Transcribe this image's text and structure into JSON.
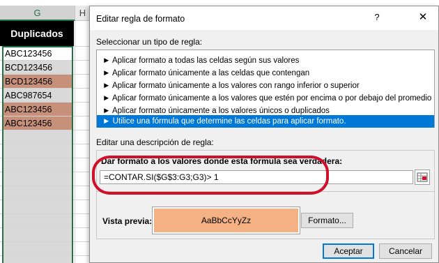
{
  "sheet": {
    "columns": [
      "G",
      "H"
    ],
    "header_cell": "Duplicados",
    "cells": [
      {
        "value": "ABC123456",
        "fill": "white"
      },
      {
        "value": "BCD123456",
        "fill": "gray"
      },
      {
        "value": "BCD123456",
        "fill": "orange"
      },
      {
        "value": "ABC987654",
        "fill": "gray"
      },
      {
        "value": "ABC123456",
        "fill": "orange"
      },
      {
        "value": "ABC123456",
        "fill": "orange"
      }
    ]
  },
  "dialog": {
    "title": "Editar regla de formato",
    "help_label": "?",
    "close_label": "✕",
    "select_rule_type_label": "Seleccionar un tipo de regla:",
    "rule_types": [
      "► Aplicar formato a todas las celdas según sus valores",
      "► Aplicar formato únicamente a las celdas que contengan",
      "► Aplicar formato únicamente a los valores con rango inferior o superior",
      "► Aplicar formato únicamente a los valores que estén por encima o por debajo del promedio",
      "► Aplicar formato únicamente a los valores únicos o duplicados",
      "► Utilice una fórmula que determine las celdas para aplicar formato."
    ],
    "selected_rule_index": 5,
    "edit_description_label": "Editar una descripción de regla:",
    "formula_label": "Dar formato a los valores donde esta fórmula sea verdadera:",
    "formula_value": "=CONTAR.SI($G$3:G3;G3)> 1",
    "preview_label": "Vista previa:",
    "preview_sample": "AaBbCcYyZz",
    "format_button": "Formato...",
    "accept_button": "Aceptar",
    "cancel_button": "Cancelar"
  },
  "colors": {
    "selection_green": "#217346",
    "highlight_orange": "#c6907a",
    "preview_fill": "#f4b183",
    "selected_rule_blue": "#0078d7",
    "annotation_red": "#d0102a"
  }
}
